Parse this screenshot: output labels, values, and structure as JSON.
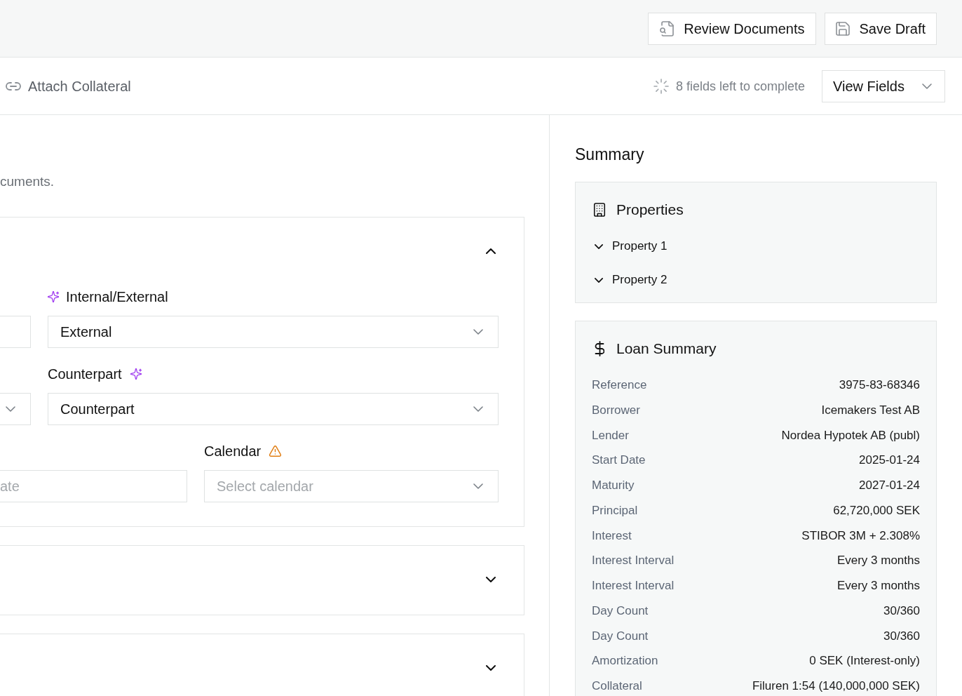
{
  "header": {
    "review_button": "Review Documents",
    "save_button": "Save Draft"
  },
  "step_bar": {
    "title": "Attach Collateral",
    "progress": "8 fields left to complete",
    "view_fields_button": "View Fields"
  },
  "form": {
    "description": "cuments.",
    "sections": [
      {
        "expanded": true,
        "rows": [
          {
            "fields": [
              {
                "kind": "input"
              },
              {
                "kind": "select",
                "label": "Internal/External",
                "label_icon": {
                  "kind": "ai",
                  "leading": true
                },
                "value": "External"
              }
            ]
          },
          {
            "fields": [
              {
                "kind": "select"
              },
              {
                "kind": "select",
                "label": "Counterpart",
                "label_icon": {
                  "kind": "ai",
                  "leading": false
                },
                "value": "Counterpart"
              }
            ]
          },
          {
            "fields": [
              {
                "kind": "input",
                "placeholder": "ate"
              },
              {
                "kind": "select",
                "label": "Calendar",
                "label_icon": {
                  "kind": "warning",
                  "leading": false
                },
                "placeholder": "Select calendar"
              }
            ]
          }
        ]
      },
      {
        "expanded": false
      },
      {
        "expanded": false
      }
    ]
  },
  "summary": {
    "title": "Summary",
    "properties": {
      "title": "Properties",
      "items": [
        {
          "label": "Property 1",
          "expanded": false
        },
        {
          "label": "Property 2",
          "expanded": false
        }
      ]
    },
    "loan_summary": {
      "title": "Loan Summary",
      "rows": [
        {
          "label": "Reference",
          "value": "3975-83-68346"
        },
        {
          "label": "Borrower",
          "value": "Icemakers Test AB"
        },
        {
          "label": "Lender",
          "value": "Nordea Hypotek AB (publ)"
        },
        {
          "label": "Start Date",
          "value": "2025-01-24"
        },
        {
          "label": "Maturity",
          "value": "2027-01-24"
        },
        {
          "label": "Principal",
          "value": "62,720,000 SEK"
        },
        {
          "label": "Interest",
          "value": "STIBOR 3M + 2.308%"
        },
        {
          "label": "Interest Interval",
          "value": "Every 3 months"
        },
        {
          "label": "Interest Interval",
          "value": "Every 3 months"
        },
        {
          "label": "Day Count",
          "value": "30/360"
        },
        {
          "label": "Day Count",
          "value": "30/360"
        },
        {
          "label": "Amortization",
          "value": "0 SEK (Interest-only)"
        },
        {
          "label": "Collateral",
          "value": "Filuren 1:54 (140,000,000 SEK)"
        }
      ]
    }
  }
}
